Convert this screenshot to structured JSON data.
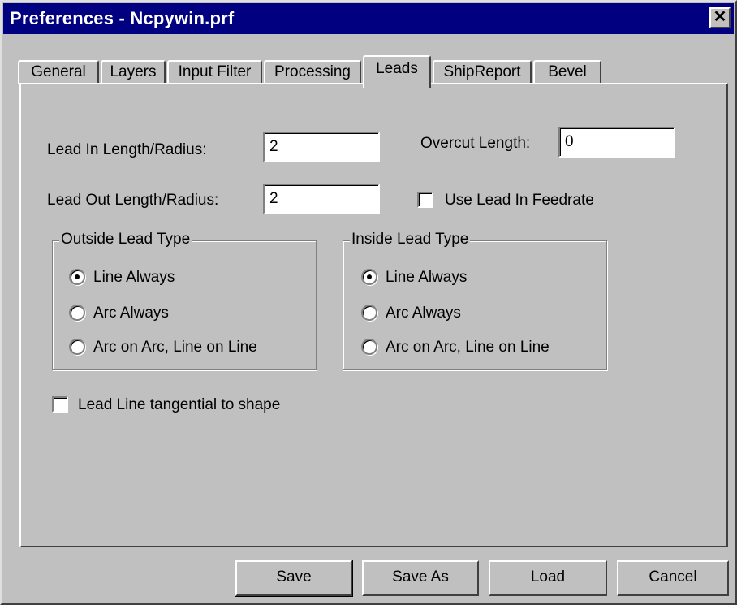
{
  "window": {
    "title": "Preferences - Ncpywin.prf",
    "close_symbol": "✕"
  },
  "tabs": [
    "General",
    "Layers",
    "Input Filter",
    "Processing",
    "Leads",
    "ShipReport",
    "Bevel"
  ],
  "active_tab": "Leads",
  "leads": {
    "lead_in_label": "Lead In Length/Radius:",
    "lead_in_value": "2",
    "lead_out_label": "Lead Out Length/Radius:",
    "lead_out_value": "2",
    "overcut_label": "Overcut Length:",
    "overcut_value": "0",
    "use_lead_in_feedrate_label": "Use Lead In Feedrate",
    "use_lead_in_feedrate_checked": false,
    "outside_group": {
      "title": "Outside Lead Type",
      "options": [
        "Line Always",
        "Arc Always",
        "Arc on Arc, Line on Line"
      ],
      "selected": "Line Always"
    },
    "inside_group": {
      "title": "Inside Lead Type",
      "options": [
        "Line Always",
        "Arc Always",
        "Arc on Arc, Line on Line"
      ],
      "selected": "Line Always"
    },
    "tangential_label": "Lead Line tangential to shape",
    "tangential_checked": false
  },
  "buttons": {
    "save": "Save",
    "save_as": "Save As",
    "load": "Load",
    "cancel": "Cancel"
  }
}
